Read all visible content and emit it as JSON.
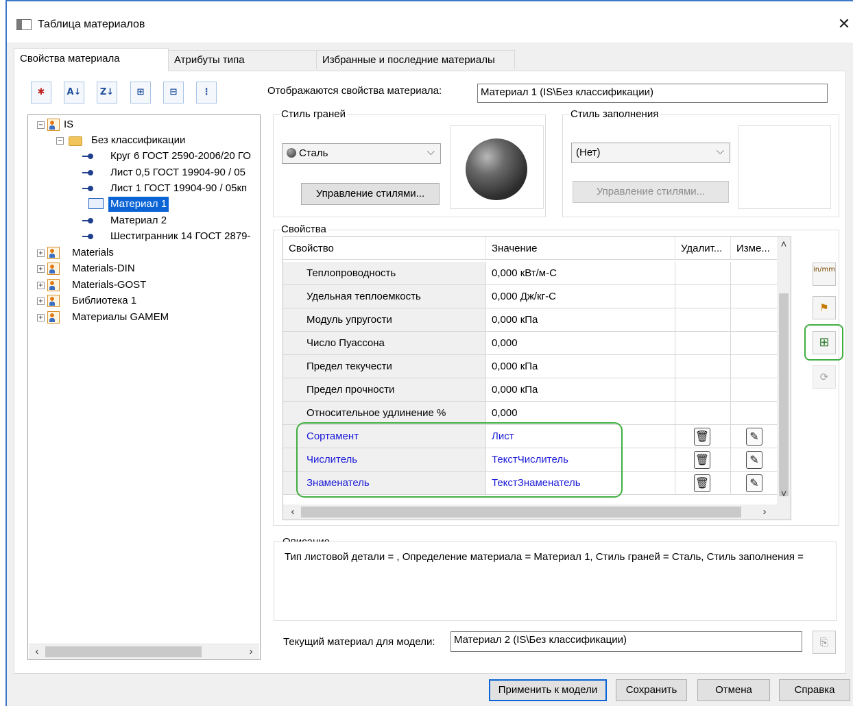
{
  "window": {
    "title": "Таблица материалов",
    "close_glyph": "✕"
  },
  "tabs": [
    "Свойства материала",
    "Атрибуты типа",
    "Избранные и последние материалы"
  ],
  "toolbar": {
    "icons": [
      "new-material-icon",
      "sort-az-icon",
      "sort-za-icon",
      "expand-tree-icon",
      "collapse-tree-icon",
      "tree-view-icon"
    ],
    "labels": [
      "✱",
      "A↓",
      "Z↓",
      "⊞",
      "⊟",
      "⋮"
    ]
  },
  "tree": {
    "items": [
      {
        "label": "IS",
        "type": "library",
        "expanded": true
      },
      {
        "label": "Без классификации",
        "type": "folder"
      },
      {
        "label": "Круг 6 ГОСТ 2590-2006/20 ГО",
        "type": "material"
      },
      {
        "label": "Лист 0,5  ГОСТ 19904-90 / 05",
        "type": "material"
      },
      {
        "label": "Лист 1  ГОСТ 19904-90 / 05кп",
        "type": "material"
      },
      {
        "label": "Материал 1",
        "type": "material",
        "selected": true
      },
      {
        "label": "Материал 2",
        "type": "material"
      },
      {
        "label": "Шестигранник 14 ГОСТ 2879-",
        "type": "material"
      },
      {
        "label": "Materials",
        "type": "library"
      },
      {
        "label": "Materials-DIN",
        "type": "library"
      },
      {
        "label": "Materials-GOST",
        "type": "library"
      },
      {
        "label": "Библиотека 1",
        "type": "library"
      },
      {
        "label": "Материалы GAMEM",
        "type": "library"
      }
    ],
    "expand_glyph": "+",
    "collapse_glyph": "−"
  },
  "shown_props": {
    "label": "Отображаются свойства материала:",
    "value": "Материал 1 (IS\\Без классификации)"
  },
  "face_style": {
    "title": "Стиль граней",
    "value": "Сталь",
    "manage_label": "Управление стилями...",
    "chevron": "⌵"
  },
  "fill_style": {
    "title": "Стиль заполнения",
    "value": "(Нет)",
    "manage_label": "Управление стилями..."
  },
  "properties": {
    "title": "Свойства",
    "columns": [
      "Свойство",
      "Значение",
      "Удалит...",
      "Изме..."
    ],
    "rows": [
      {
        "name": "Теплопроводность",
        "value": "0,000 кВт/м-С",
        "custom": false
      },
      {
        "name": "Удельная теплоемкость",
        "value": "0,000 Дж/кг-С",
        "custom": false
      },
      {
        "name": "Модуль упругости",
        "value": "0,000 кПа",
        "custom": false
      },
      {
        "name": "Число Пуассона",
        "value": "0,000",
        "custom": false
      },
      {
        "name": "Предел текучести",
        "value": "0,000 кПа",
        "custom": false
      },
      {
        "name": "Предел прочности",
        "value": "0,000 кПа",
        "custom": false
      },
      {
        "name": "Относительное удлинение %",
        "value": "0,000",
        "custom": false
      },
      {
        "name": "Сортамент",
        "value": "Лист",
        "custom": true
      },
      {
        "name": "Числитель",
        "value": "ТекстЧислитель",
        "custom": true
      },
      {
        "name": "Знаменатель",
        "value": "ТекстЗнаменатель",
        "custom": true
      }
    ],
    "delete_glyph": "🗑",
    "edit_glyph": "✎",
    "custom_color": "#1a1ad9"
  },
  "side_buttons": [
    {
      "icon": "units-icon",
      "glyph": "in/mm"
    },
    {
      "icon": "assign-material-icon",
      "glyph": "⚑"
    },
    {
      "icon": "add-property-icon",
      "glyph": "⊞"
    },
    {
      "icon": "refresh-icon",
      "glyph": "⟳"
    }
  ],
  "description": {
    "title": "Описание",
    "text": "Тип листовой детали = , Определение материала = Материал 1, Стиль граней = Сталь, Стиль заполнения ="
  },
  "current_material": {
    "label": "Текущий материал для модели:",
    "value": "Материал 2 (IS\\Без классификации)"
  },
  "buttons": {
    "apply": "Применить к модели",
    "save": "Сохранить",
    "cancel": "Отмена",
    "help": "Справка"
  },
  "highlight_color": "#3fae3f"
}
